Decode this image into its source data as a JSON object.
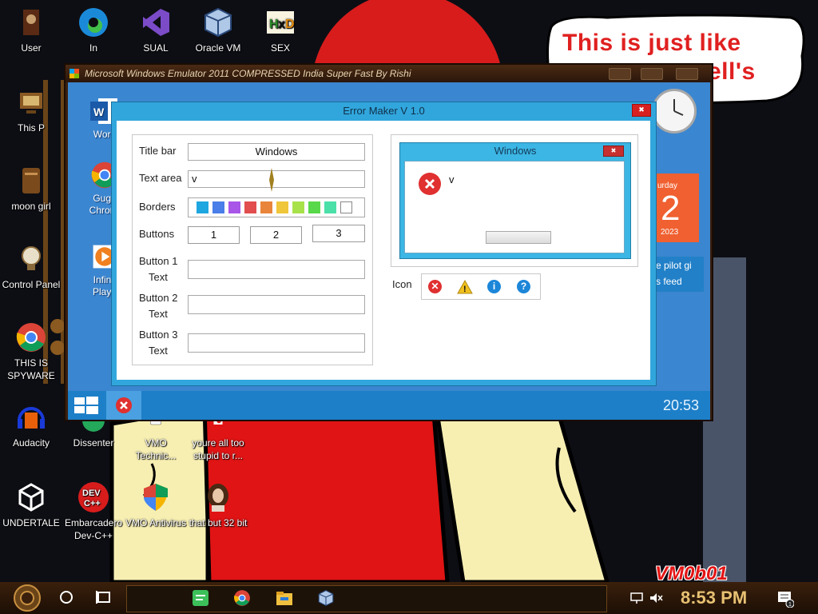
{
  "host_desktop": {
    "icons": [
      {
        "label": "User",
        "icon": "user-folder-icon"
      },
      {
        "label": "In",
        "icon": "edge-icon"
      },
      {
        "label": "SUAL",
        "icon": "visual-studio-icon"
      },
      {
        "label": "Oracle VM",
        "icon": "virtualbox-icon"
      },
      {
        "label": "SEX",
        "icon": "hxd-icon"
      },
      {
        "label": "This P",
        "icon": "this-pc-icon"
      },
      {
        "label": "moon girl",
        "icon": "moon-girl-icon"
      },
      {
        "label": "Control Panel",
        "icon": "control-panel-icon"
      },
      {
        "label": "THIS IS SPYWARE",
        "icon": "chrome-icon"
      },
      {
        "label": "Audacity",
        "icon": "audacity-icon"
      },
      {
        "label": "Dissenter",
        "icon": "dissenter-icon"
      },
      {
        "label": "VMO Technic...",
        "icon": "vmo-technic-icon"
      },
      {
        "label": "youre all too stupid to r...",
        "icon": "shortcut-icon"
      },
      {
        "label": "UNDERTALE",
        "icon": "unity-icon"
      },
      {
        "label": "Embarcadero Dev-C++",
        "icon": "devcpp-icon"
      },
      {
        "label": "VMO Antivirus",
        "icon": "antivirus-shield-icon"
      },
      {
        "label": "that but 32 bit",
        "icon": "portrait-icon"
      }
    ],
    "speech_bubble": {
      "line1": "This is just like",
      "line2": "ell's"
    },
    "watermark": "VM0b01",
    "taskbar": {
      "clock": "8:53 PM"
    }
  },
  "emulator": {
    "title": "Microsoft Windows Emulator 2011 COMPRESSED India Super Fast By Rishi",
    "desktop_icons": [
      {
        "label": "Word",
        "icon": "word-icon"
      },
      {
        "label": "Gugo Chromi",
        "icon": "chrome-icon"
      },
      {
        "label": "Infinit Playe",
        "icon": "media-player-icon"
      }
    ],
    "calendar": {
      "day_name": "urday",
      "day": "2",
      "year": "2023"
    },
    "news_tile": {
      "line1": "e pilot gi",
      "line2": "s feed"
    },
    "taskbar": {
      "clock": "20:53"
    }
  },
  "error_maker": {
    "title": "Error Maker V 1.0",
    "labels": {
      "title_bar": "Title bar",
      "text_area": "Text area",
      "borders": "Borders",
      "buttons": "Buttons",
      "button1_l1": "Button 1",
      "button1_l2": "Text",
      "button2_l1": "Button 2",
      "button2_l2": "Text",
      "button3_l1": "Button 3",
      "button3_l2": "Text",
      "icon": "Icon"
    },
    "title_bar_value": "Windows",
    "text_area_value": "v",
    "button1_text": "",
    "button2_text": "",
    "button3_text": "",
    "button_count_options": [
      "1",
      "2",
      "3"
    ],
    "border_colors": [
      "#1ea6e0",
      "#4a7ee8",
      "#a855e8",
      "#e24d4d",
      "#e8853a",
      "#f0c63a",
      "#a8e24a",
      "#58d84a",
      "#4ae0a8",
      "#ffffff"
    ],
    "preview": {
      "title": "Windows",
      "message": "v"
    },
    "icon_options": [
      {
        "name": "error-icon",
        "glyph": "✕",
        "color": "#e03030"
      },
      {
        "name": "warning-icon",
        "glyph": "!",
        "color": "#f0c020"
      },
      {
        "name": "info-icon",
        "glyph": "i",
        "color": "#1c86d8"
      },
      {
        "name": "question-icon",
        "glyph": "?",
        "color": "#1c86d8"
      }
    ]
  }
}
